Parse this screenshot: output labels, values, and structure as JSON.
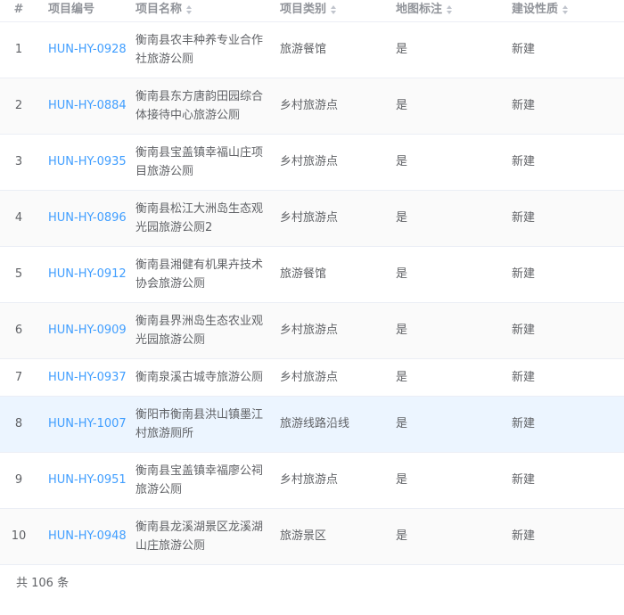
{
  "table": {
    "headers": {
      "idx": "#",
      "code": "项目编号",
      "name": "项目名称",
      "type": "项目类别",
      "map": "地图标注",
      "prop": "建设性质"
    },
    "rows": [
      {
        "idx": "1",
        "code": "HUN-HY-0928",
        "name": "衡南县农丰种养专业合作社旅游公厕",
        "type": "旅游餐馆",
        "map": "是",
        "prop": "新建"
      },
      {
        "idx": "2",
        "code": "HUN-HY-0884",
        "name": "衡南县东方唐韵田园综合体接待中心旅游公厕",
        "type": "乡村旅游点",
        "map": "是",
        "prop": "新建"
      },
      {
        "idx": "3",
        "code": "HUN-HY-0935",
        "name": "衡南县宝盖镇幸福山庄项目旅游公厕",
        "type": "乡村旅游点",
        "map": "是",
        "prop": "新建"
      },
      {
        "idx": "4",
        "code": "HUN-HY-0896",
        "name": "衡南县松江大洲岛生态观光园旅游公厕2",
        "type": "乡村旅游点",
        "map": "是",
        "prop": "新建"
      },
      {
        "idx": "5",
        "code": "HUN-HY-0912",
        "name": "衡南县湘健有机果卉技术协会旅游公厕",
        "type": "旅游餐馆",
        "map": "是",
        "prop": "新建"
      },
      {
        "idx": "6",
        "code": "HUN-HY-0909",
        "name": "衡南县界洲岛生态农业观光园旅游公厕",
        "type": "乡村旅游点",
        "map": "是",
        "prop": "新建"
      },
      {
        "idx": "7",
        "code": "HUN-HY-0937",
        "name": "衡南泉溪古城寺旅游公厕",
        "type": "乡村旅游点",
        "map": "是",
        "prop": "新建"
      },
      {
        "idx": "8",
        "code": "HUN-HY-1007",
        "name": "衡阳市衡南县洪山镇墨江村旅游厕所",
        "type": "旅游线路沿线",
        "map": "是",
        "prop": "新建"
      },
      {
        "idx": "9",
        "code": "HUN-HY-0951",
        "name": "衡南县宝盖镇幸福廖公祠旅游公厕",
        "type": "乡村旅游点",
        "map": "是",
        "prop": "新建"
      },
      {
        "idx": "10",
        "code": "HUN-HY-0948",
        "name": "衡南县龙溪湖景区龙溪湖山庄旅游公厕",
        "type": "旅游景区",
        "map": "是",
        "prop": "新建"
      }
    ]
  },
  "footer": {
    "total_text": "共 106 条"
  }
}
